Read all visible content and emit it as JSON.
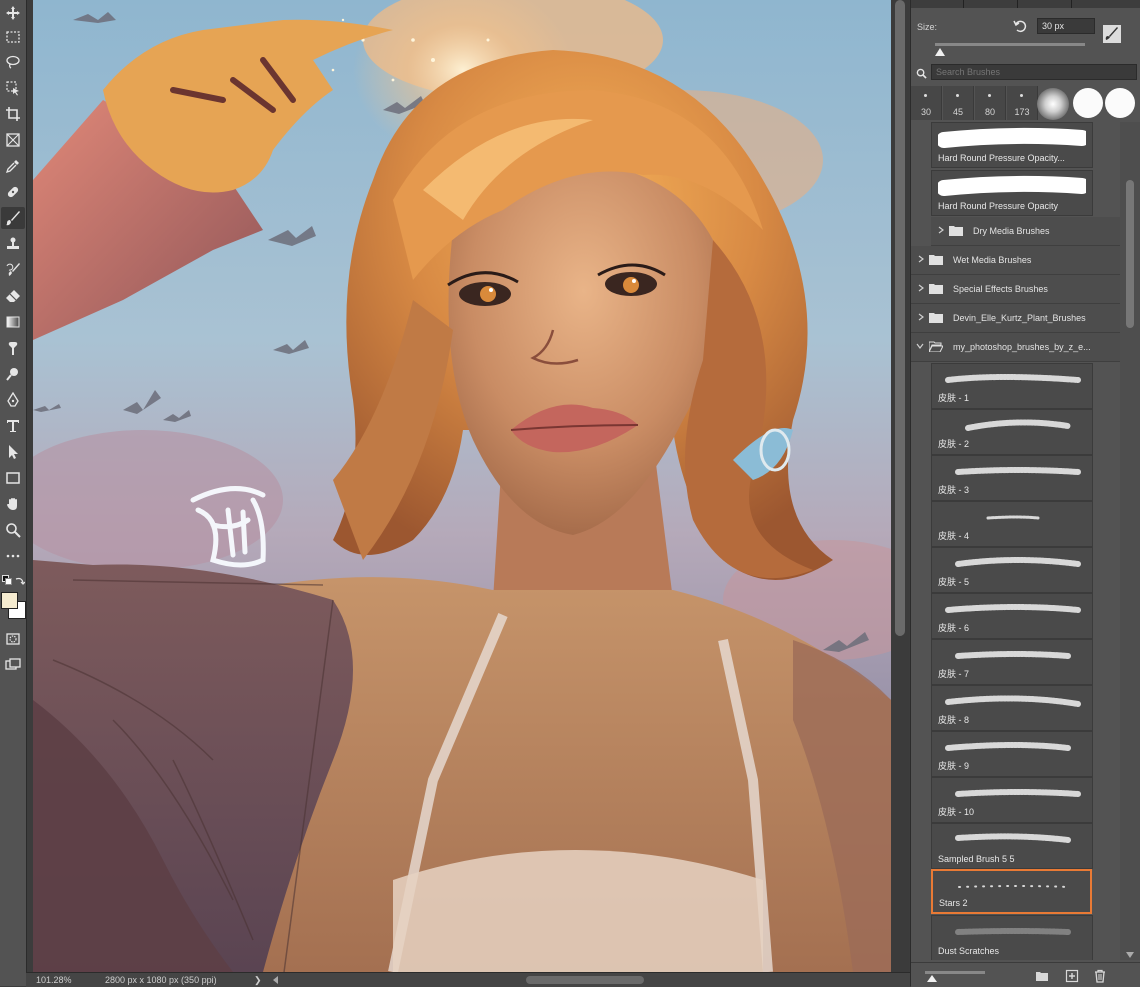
{
  "status": {
    "zoom": "101.28%",
    "doc_info": "2800 px x 1080 px (350 ppi)",
    "arrow": "❯"
  },
  "brushes_panel": {
    "size_label": "Size:",
    "size_value": "30 px",
    "search_placeholder": "Search Brushes",
    "presets": [
      "30",
      "45",
      "80",
      "173"
    ],
    "top_brushes": [
      {
        "label": "Hard Round Pressure Opacity..."
      },
      {
        "label": "Hard Round Pressure Opacity"
      }
    ],
    "folders": [
      {
        "label": "Dry Media Brushes",
        "open": false,
        "nested": true
      },
      {
        "label": "Wet Media Brushes",
        "open": false,
        "nested": false
      },
      {
        "label": "Special Effects Brushes",
        "open": false,
        "nested": false
      },
      {
        "label": "Devin_Elle_Kurtz_Plant_Brushes",
        "open": false,
        "nested": false
      },
      {
        "label": "my_photoshop_brushes_by_z_e...",
        "open": true,
        "nested": false
      }
    ],
    "brushes": [
      {
        "label": "皮肤 - 1"
      },
      {
        "label": "皮肤 - 2"
      },
      {
        "label": "皮肤 - 3"
      },
      {
        "label": "皮肤 - 4"
      },
      {
        "label": "皮肤 - 5"
      },
      {
        "label": "皮肤 - 6"
      },
      {
        "label": "皮肤 - 7"
      },
      {
        "label": "皮肤 - 8"
      },
      {
        "label": "皮肤 - 9"
      },
      {
        "label": "皮肤 - 10"
      },
      {
        "label": "Sampled Brush 5 5"
      },
      {
        "label": "Stars 2",
        "selected": true
      },
      {
        "label": "Dust Scratches"
      }
    ]
  },
  "colors": {
    "foreground": "#f6ecd0",
    "background": "#ffffff",
    "selection_accent": "#e97a35"
  },
  "tools": [
    "move-tool",
    "marquee-tool",
    "lasso-tool",
    "object-selection-tool",
    "crop-tool",
    "frame-tool",
    "eyedropper-tool",
    "healing-brush-tool",
    "brush-tool",
    "clone-stamp-tool",
    "history-brush-tool",
    "eraser-tool",
    "gradient-tool",
    "smudge-tool",
    "dodge-tool",
    "pen-tool",
    "type-tool",
    "path-selection-tool",
    "rectangle-tool",
    "hand-tool",
    "zoom-tool",
    "more-tools"
  ]
}
